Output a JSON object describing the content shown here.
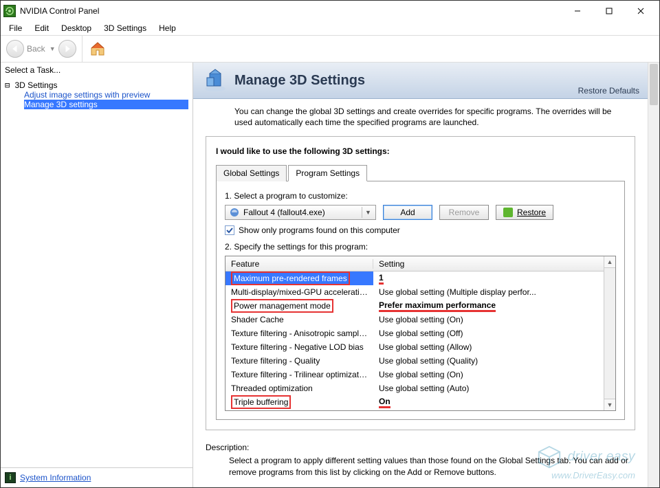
{
  "window": {
    "title": "NVIDIA Control Panel"
  },
  "menu": {
    "items": [
      "File",
      "Edit",
      "Desktop",
      "3D Settings",
      "Help"
    ]
  },
  "toolbar": {
    "back_label": "Back"
  },
  "sidebar": {
    "header": "Select a Task...",
    "root": "3D Settings",
    "items": [
      {
        "label": "Adjust image settings with preview",
        "selected": false
      },
      {
        "label": "Manage 3D settings",
        "selected": true
      }
    ],
    "sysinfo_label": "System Information"
  },
  "page": {
    "title": "Manage 3D Settings",
    "restore_defaults": "Restore Defaults",
    "intro": "You can change the global 3D settings and create overrides for specific programs. The overrides will be used automatically each time the specified programs are launched.",
    "group_title": "I would like to use the following 3D settings:",
    "tabs": {
      "global": "Global Settings",
      "program": "Program Settings"
    },
    "step1": "1. Select a program to customize:",
    "program_selected": "Fallout 4 (fallout4.exe)",
    "add_btn": "Add",
    "remove_btn": "Remove",
    "restore_btn": "Restore",
    "checkbox_label": "Show only programs found on this computer",
    "step2": "2. Specify the settings for this program:",
    "table": {
      "col_feature": "Feature",
      "col_setting": "Setting",
      "rows": [
        {
          "feature": "Maximum pre-rendered frames",
          "setting": "1",
          "selected": true,
          "bold_setting": true,
          "box_feature": true,
          "underline_setting": true
        },
        {
          "feature": "Multi-display/mixed-GPU acceleration",
          "setting": "Use global setting (Multiple display perfor..."
        },
        {
          "feature": "Power management mode",
          "setting": "Prefer maximum performance",
          "bold_setting": true,
          "box_feature": true,
          "underline_setting": true
        },
        {
          "feature": "Shader Cache",
          "setting": "Use global setting (On)"
        },
        {
          "feature": "Texture filtering - Anisotropic sample opti...",
          "setting": "Use global setting (Off)"
        },
        {
          "feature": "Texture filtering - Negative LOD bias",
          "setting": "Use global setting (Allow)"
        },
        {
          "feature": "Texture filtering - Quality",
          "setting": "Use global setting (Quality)"
        },
        {
          "feature": "Texture filtering - Trilinear optimization",
          "setting": "Use global setting (On)"
        },
        {
          "feature": "Threaded optimization",
          "setting": "Use global setting (Auto)"
        },
        {
          "feature": "Triple buffering",
          "setting": "On",
          "bold_setting": true,
          "box_feature": true,
          "underline_setting": true
        }
      ]
    },
    "description_title": "Description:",
    "description_body": "Select a program to apply different setting values than those found on the Global Settings tab. You can add or remove programs from this list by clicking on the Add or Remove buttons."
  },
  "watermark": {
    "brand": "driver easy",
    "url": "www.DriverEasy.com"
  }
}
